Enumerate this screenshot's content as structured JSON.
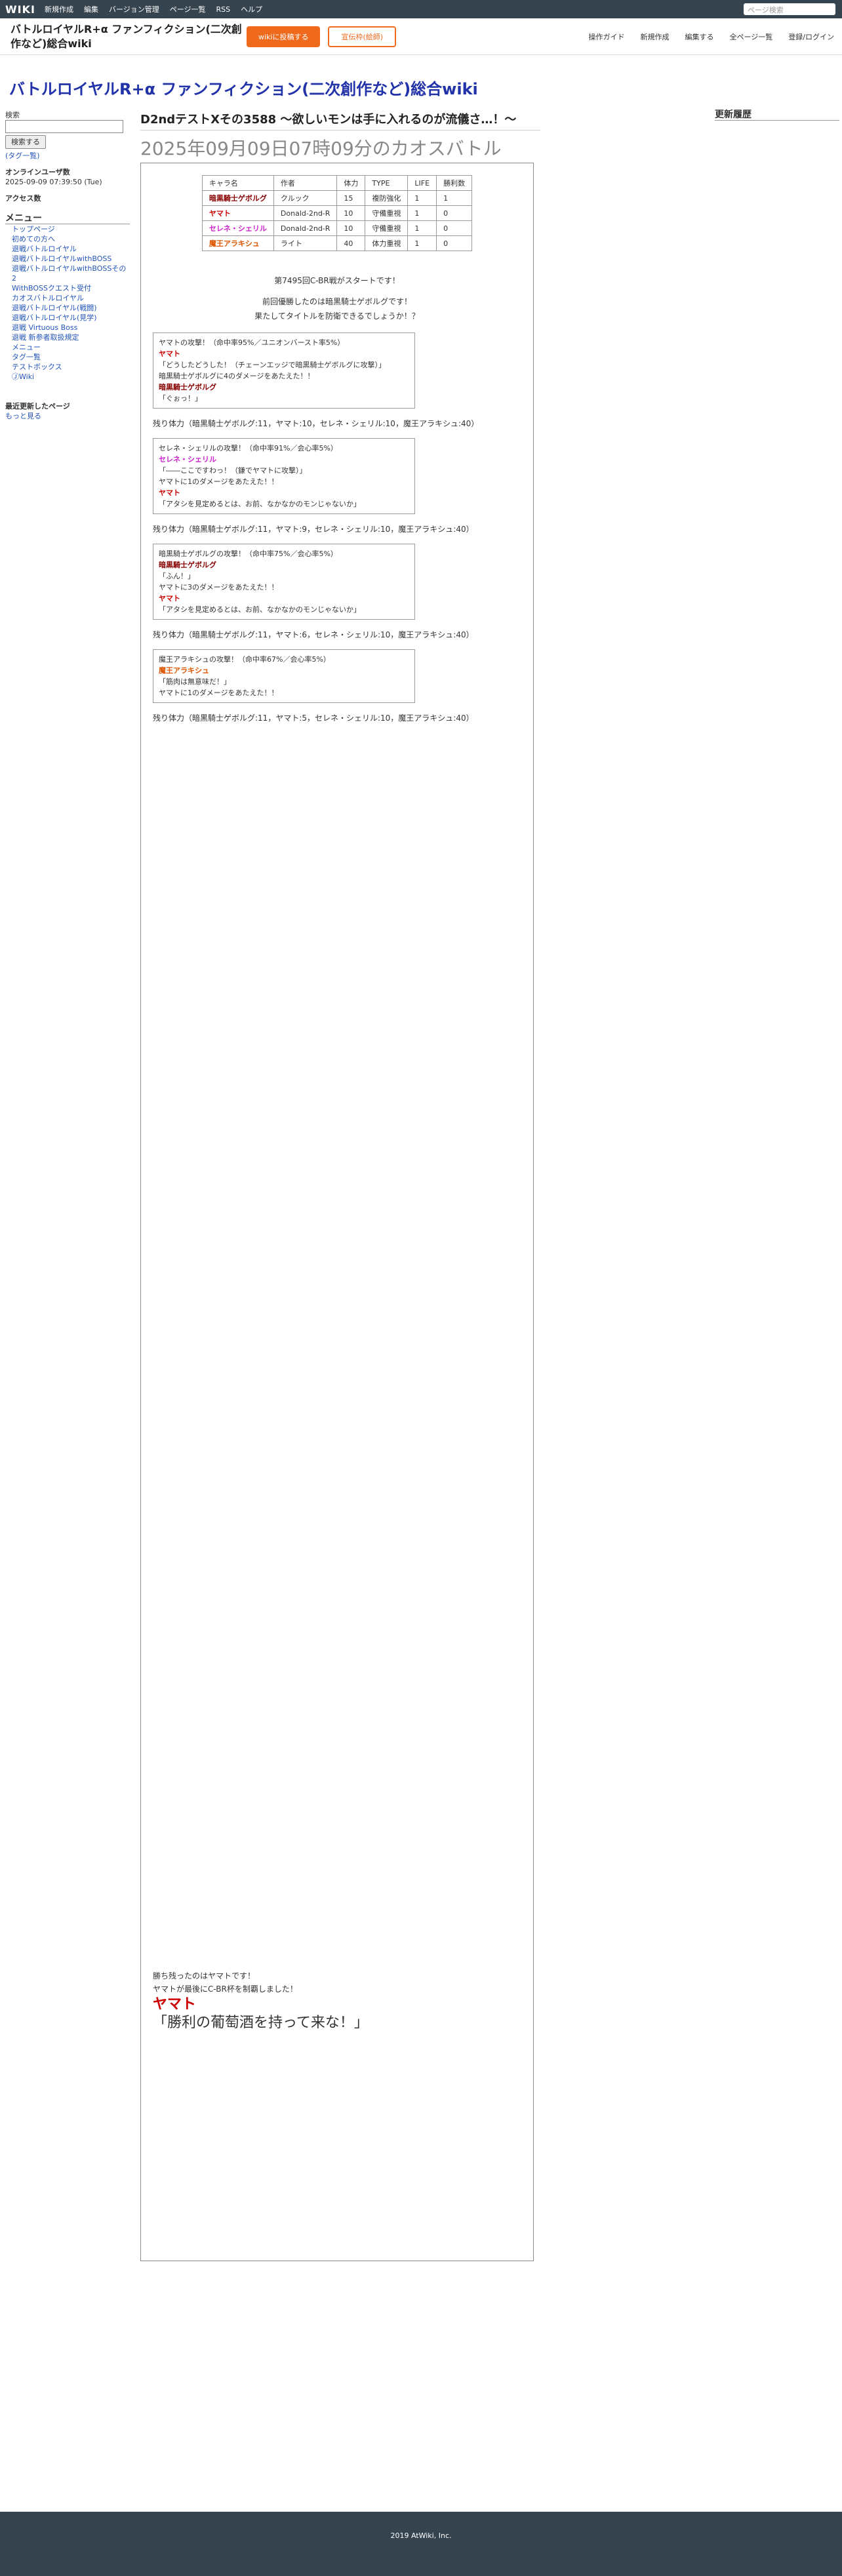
{
  "topbar": {
    "logo": "WIKI",
    "menus": [
      "新規作成",
      "編集",
      "バージョン管理",
      "ページ一覧",
      "RSS",
      "ヘルプ"
    ],
    "search_placeholder": "ページ検索"
  },
  "header2": {
    "wiki_name": "バトルロイヤルR+α ファンフィクション(二次創作など)総合wiki",
    "btn_orange": "wikiに投稿する",
    "btn_white": "宣伝枠(絵師)",
    "tools": [
      "操作ガイド",
      "新規作成",
      "編集する",
      "全ページ一覧",
      "登録/ログイン"
    ]
  },
  "site_title": "バトルロイヤルR+α ファンフィクション(二次創作など)総合wiki",
  "left": {
    "search_label": "検索",
    "search_btn": "検索する",
    "tag": "(タグ一覧)",
    "online": "オンラインユーザ数",
    "date": "2025-09-09 07:39:50 (Tue)",
    "access": "アクセス数",
    "menu": "メニュー",
    "items": [
      "トップページ",
      "初めての方へ",
      "退戦バトルロイヤル",
      "退戦バトルロイヤルwithBOSS",
      "退戦バトルロイヤルwithBOSSその2",
      "WithBOSSクエスト受付",
      "カオスバトルロイヤル",
      "退戦バトルロイヤル(戦闘)",
      "退戦バトルロイヤル(見学)",
      "退戦 Virtuous Boss",
      "退戦 新参者取扱規定",
      "メニュー",
      "タグ一覧",
      "テストボックス",
      "ⒿWiki"
    ],
    "recent_h": "最近更新したページ",
    "more": "もっと見る"
  },
  "main": {
    "page_title": "D2ndテストXその3588 ～欲しいモンは手に入れるのが流儀さ…！～",
    "heading": "2025年09月09日07時09分のカオスバトル"
  },
  "table": {
    "header": [
      "キャラ名",
      "作者",
      "体力",
      "TYPE",
      "LIFE",
      "勝利数"
    ],
    "rows": [
      [
        "暗黒騎士ゲボルグ",
        "クルック",
        "15",
        "複防強化",
        "1",
        "1"
      ],
      [
        "ヤマト",
        "Donald-2nd-R",
        "10",
        "守備重視",
        "1",
        "0"
      ],
      [
        "セレネ・シェリル",
        "Donald-2nd-R",
        "10",
        "守備重視",
        "1",
        "0"
      ],
      [
        "魔王アラキシュ",
        "ライト",
        "40",
        "体力重視",
        "1",
        "0"
      ]
    ]
  },
  "intro": [
    "第7495回C-BR戦がスタートです！",
    "前回優勝したのは暗黒騎士ゲボルグです！",
    "果たしてタイトルを防衛できるでしょうか！？"
  ],
  "boxes": [
    [
      "ヤマトの攻撃！（命中率95%／ユニオンバースト率5%）",
      "ヤマト",
      "「どうしたどうした！（チェーンエッジで暗黒騎士ゲボルグに攻撃）」",
      "暗黒騎士ゲボルグに4のダメージをあたえた！！",
      "暗黒騎士ゲボルグ",
      "「ぐぉっ！」"
    ],
    [
      "セレネ・シェリルの攻撃！（命中率91%／会心率5%）",
      "セレネ・シェリル",
      "「――ここですわっ！（鎌でヤマトに攻撃）」",
      "ヤマトに1のダメージをあたえた！！",
      "ヤマト",
      "「アタシを見定めるとは、お前、なかなかのモンじゃないか」"
    ],
    [
      "暗黒騎士ゲボルグの攻撃！（命中率75%／会心率5%）",
      "暗黒騎士ゲボルグ",
      "「ふん！」",
      "ヤマトに3のダメージをあたえた！！",
      "ヤマト",
      "「アタシを見定めるとは、お前、なかなかのモンじゃないか」"
    ],
    [
      "魔王アラキシュの攻撃！（命中率67%／会心率5%）",
      "魔王アラキシュ",
      "「筋肉は無意味だ！」",
      "ヤマトに1のダメージをあたえた！！"
    ]
  ],
  "remain": [
    "残り体力（暗黒騎士ゲボルグ:11，ヤマト:10，セレネ・シェリル:10，魔王アラキシュ:40）",
    "残り体力（暗黒騎士ゲボルグ:11，ヤマト:9，セレネ・シェリル:10，魔王アラキシュ:40）",
    "残り体力（暗黒騎士ゲボルグ:11，ヤマト:6，セレネ・シェリル:10，魔王アラキシュ:40）",
    "残り体力（暗黒騎士ゲボルグ:11，ヤマト:5，セレネ・シェリル:10，魔王アラキシュ:40）"
  ],
  "final": [
    "勝ち残ったのはヤマトです！",
    "ヤマトが最後にC-BR杯を制覇しました！",
    "ヤマト",
    "「勝利の葡萄酒を持って来な！」"
  ],
  "footer": "2019 AtWiki, Inc."
}
